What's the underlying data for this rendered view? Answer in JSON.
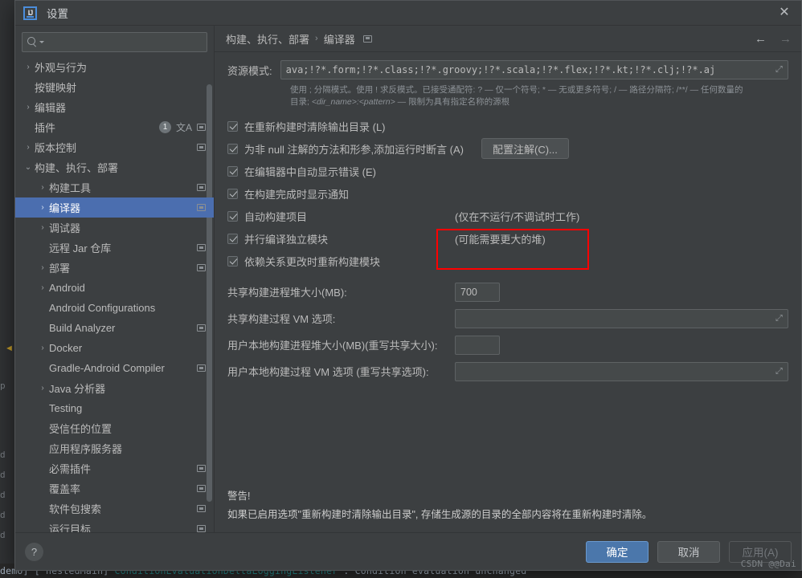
{
  "window": {
    "title": "设置",
    "logo_text": "IJ",
    "close_icon": "close-icon"
  },
  "search": {
    "value": "",
    "placeholder": ""
  },
  "sidebar": {
    "items": [
      {
        "label": "外观与行为",
        "twisty": "›",
        "indent": 0,
        "selected": false,
        "copy": false,
        "badge": null,
        "translate": false
      },
      {
        "label": "按键映射",
        "twisty": "",
        "indent": 0,
        "selected": false,
        "copy": false,
        "badge": null,
        "translate": false
      },
      {
        "label": "编辑器",
        "twisty": "›",
        "indent": 0,
        "selected": false,
        "copy": false,
        "badge": null,
        "translate": false
      },
      {
        "label": "插件",
        "twisty": "",
        "indent": 0,
        "selected": false,
        "copy": true,
        "badge": "1",
        "translate": true
      },
      {
        "label": "版本控制",
        "twisty": "›",
        "indent": 0,
        "selected": false,
        "copy": true,
        "badge": null,
        "translate": false
      },
      {
        "label": "构建、执行、部署",
        "twisty": "⌄",
        "indent": 0,
        "selected": false,
        "copy": false,
        "badge": null,
        "translate": false
      },
      {
        "label": "构建工具",
        "twisty": "›",
        "indent": 1,
        "selected": false,
        "copy": true,
        "badge": null,
        "translate": false
      },
      {
        "label": "编译器",
        "twisty": "›",
        "indent": 1,
        "selected": true,
        "copy": true,
        "badge": null,
        "translate": false
      },
      {
        "label": "调试器",
        "twisty": "›",
        "indent": 1,
        "selected": false,
        "copy": false,
        "badge": null,
        "translate": false
      },
      {
        "label": "远程 Jar 仓库",
        "twisty": "",
        "indent": 1,
        "selected": false,
        "copy": true,
        "badge": null,
        "translate": false
      },
      {
        "label": "部署",
        "twisty": "›",
        "indent": 1,
        "selected": false,
        "copy": true,
        "badge": null,
        "translate": false
      },
      {
        "label": "Android",
        "twisty": "›",
        "indent": 1,
        "selected": false,
        "copy": false,
        "badge": null,
        "translate": false
      },
      {
        "label": "Android Configurations",
        "twisty": "",
        "indent": 1,
        "selected": false,
        "copy": false,
        "badge": null,
        "translate": false
      },
      {
        "label": "Build Analyzer",
        "twisty": "",
        "indent": 1,
        "selected": false,
        "copy": true,
        "badge": null,
        "translate": false
      },
      {
        "label": "Docker",
        "twisty": "›",
        "indent": 1,
        "selected": false,
        "copy": false,
        "badge": null,
        "translate": false
      },
      {
        "label": "Gradle-Android Compiler",
        "twisty": "",
        "indent": 1,
        "selected": false,
        "copy": true,
        "badge": null,
        "translate": false
      },
      {
        "label": "Java 分析器",
        "twisty": "›",
        "indent": 1,
        "selected": false,
        "copy": false,
        "badge": null,
        "translate": false
      },
      {
        "label": "Testing",
        "twisty": "",
        "indent": 1,
        "selected": false,
        "copy": false,
        "badge": null,
        "translate": false
      },
      {
        "label": "受信任的位置",
        "twisty": "",
        "indent": 1,
        "selected": false,
        "copy": false,
        "badge": null,
        "translate": false
      },
      {
        "label": "应用程序服务器",
        "twisty": "",
        "indent": 1,
        "selected": false,
        "copy": false,
        "badge": null,
        "translate": false
      },
      {
        "label": "必需插件",
        "twisty": "",
        "indent": 1,
        "selected": false,
        "copy": true,
        "badge": null,
        "translate": false
      },
      {
        "label": "覆盖率",
        "twisty": "",
        "indent": 1,
        "selected": false,
        "copy": true,
        "badge": null,
        "translate": false
      },
      {
        "label": "软件包搜索",
        "twisty": "",
        "indent": 1,
        "selected": false,
        "copy": true,
        "badge": null,
        "translate": false
      },
      {
        "label": "运行目标",
        "twisty": "",
        "indent": 1,
        "selected": false,
        "copy": true,
        "badge": null,
        "translate": false
      }
    ]
  },
  "breadcrumb": {
    "parent": "构建、执行、部署",
    "separator": "›",
    "current": "编译器",
    "copy_icon": "copy-icon",
    "back_icon": "arrow-left-icon",
    "forward_icon": "arrow-right-icon"
  },
  "main": {
    "resource_label": "资源模式:",
    "resource_value": "ava;!?*.form;!?*.class;!?*.groovy;!?*.scala;!?*.flex;!?*.kt;!?*.clj;!?*.aj",
    "resource_hint_line1": "使用 ; 分隔模式。使用 ! 求反模式。已接受通配符: ? — 仅一个符号; * — 无或更多符号; / — 路径分隔符; /**/ — 任何数量的",
    "resource_hint_line2_pre": "目录; ",
    "resource_hint_line2_em": "<dir_name>:<pattern>",
    "resource_hint_line2_post": " — 限制为具有指定名称的源根",
    "checkboxes": [
      {
        "label": "在重新构建时清除输出目录 (L)",
        "checked": true,
        "note": ""
      },
      {
        "label": "为非 null 注解的方法和形参,添加运行时断言 (A)",
        "checked": true,
        "note": ""
      },
      {
        "label": "在编辑器中自动显示错误 (E)",
        "checked": true,
        "note": ""
      },
      {
        "label": "在构建完成时显示通知",
        "checked": true,
        "note": ""
      },
      {
        "label": "自动构建项目",
        "checked": true,
        "note": "(仅在不运行/不调试时工作)"
      },
      {
        "label": "并行编译独立模块",
        "checked": true,
        "note": "(可能需要更大的堆)"
      },
      {
        "label": "依赖关系更改时重新构建模块",
        "checked": true,
        "note": ""
      }
    ],
    "configure_annotations_button": "配置注解(C)...",
    "fields": [
      {
        "label": "共享构建进程堆大小(MB):",
        "value": "700",
        "kind": "small"
      },
      {
        "label": "共享构建过程 VM 选项:",
        "value": "",
        "kind": "wide"
      },
      {
        "label": "用户本地构建进程堆大小(MB)(重写共享大小):",
        "value": "",
        "kind": "small"
      },
      {
        "label": "用户本地构建过程 VM 选项 (重写共享选项):",
        "value": "",
        "kind": "wide"
      }
    ],
    "warning_title": "警告!",
    "warning_text": "如果已启用选项\"重新构建时清除输出目录\", 存储生成源的目录的全部内容将在重新构建时清除。"
  },
  "footer": {
    "help_label": "?",
    "ok_label": "确定",
    "cancel_label": "取消",
    "apply_label": "应用(A)"
  },
  "watermark": "CSDN @@Dai",
  "background": {
    "log_pre": "demo] [  nestedMain] ",
    "log_class": "ConditionEvaluationDeltaLoggingListener",
    "log_post": " : Condition evaluation unchanged",
    "gutter_marks": [
      "p",
      "d",
      "d",
      "d",
      "d",
      "d"
    ]
  },
  "colors": {
    "accent": "#4b77ab",
    "selection": "#4b6eaf",
    "highlight_box": "#ff0000",
    "panel": "#3c3f41",
    "field": "#45494a"
  }
}
